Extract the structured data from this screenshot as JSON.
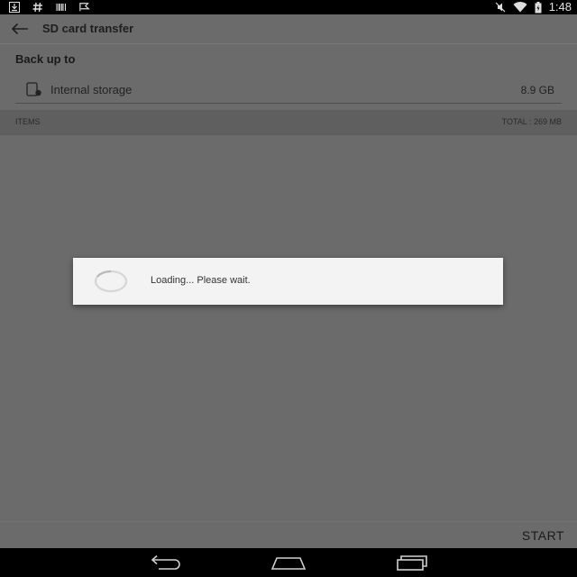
{
  "status_bar": {
    "time": "1:48",
    "left_icons": [
      "download-icon",
      "hash-icon",
      "barcode-icon",
      "flag-icon"
    ],
    "right_icons": [
      "mute-icon",
      "wifi-icon",
      "battery-icon"
    ]
  },
  "toolbar": {
    "title": "SD card transfer",
    "back_icon": "back-arrow-icon"
  },
  "backup": {
    "section_label": "Back up to",
    "target_name": "Internal storage",
    "target_size": "8.9 GB",
    "target_icon": "storage-icon"
  },
  "items": {
    "label": "ITEMS",
    "total": "TOTAL : 269 MB"
  },
  "bottom": {
    "start_label": "START"
  },
  "dialog": {
    "message": "Loading... Please wait."
  },
  "nav_bar": {
    "buttons": [
      "back-icon",
      "home-icon",
      "recents-icon"
    ]
  },
  "colors": {
    "scrim": "#6b6b6b",
    "dialog_bg": "#f3f3f3",
    "bars": "#000000"
  }
}
